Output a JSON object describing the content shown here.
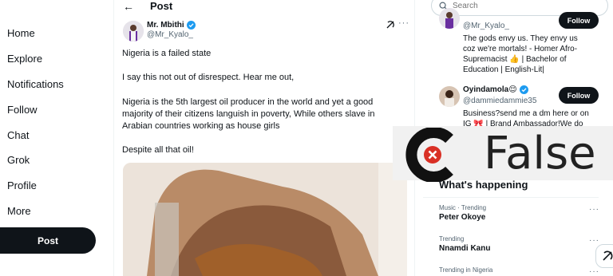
{
  "nav": {
    "items": [
      {
        "label": "Home"
      },
      {
        "label": "Explore"
      },
      {
        "label": "Notifications"
      },
      {
        "label": "Follow"
      },
      {
        "label": "Chat"
      },
      {
        "label": "Grok"
      },
      {
        "label": "Profile"
      },
      {
        "label": "More"
      }
    ],
    "post_button": "Post"
  },
  "header": {
    "back_icon": "arrow-left-icon",
    "title": "Post"
  },
  "tweet": {
    "author_name": "Mr. Mbithi",
    "author_handle": "@Mr_Kyalo_",
    "verified": true,
    "paragraphs": [
      "Nigeria is a failed state",
      "I say this not out of disrespect. Hear me out,",
      "Nigeria is the 5th largest oil producer in the world and yet a good majority of their citizens languish in poverty, While others slave in Arabian countries working as house girls",
      "Despite all that oil!"
    ]
  },
  "search": {
    "placeholder": "Search"
  },
  "who_to_follow": [
    {
      "handle": "@Mr_Kyalo_",
      "bio": "The gods envy us. They envy us coz we're mortals! - Homer Afro-Supremacist 👍 | Bachelor of Education | English-Lit|",
      "button": "Follow"
    },
    {
      "name": "Oyindamola😌",
      "handle": "@dammiedammie35",
      "bio": "Business?send me a dm here or on IG 🎀 | Brand Ambassador!We do",
      "button": "Follow"
    }
  ],
  "overlay": {
    "label": "False"
  },
  "happening": {
    "title": "What's happening",
    "trends": [
      {
        "context": "Music · Trending",
        "name": "Peter Okoye"
      },
      {
        "context": "Trending",
        "name": "Nnamdi Kanu"
      },
      {
        "context": "Trending in Nigeria",
        "name": ""
      }
    ]
  },
  "colors": {
    "text_primary": "#0f1419",
    "text_secondary": "#536471",
    "verified_blue": "#1d9bf0",
    "overlay_red": "#d93025",
    "button_black": "#0f1419"
  }
}
